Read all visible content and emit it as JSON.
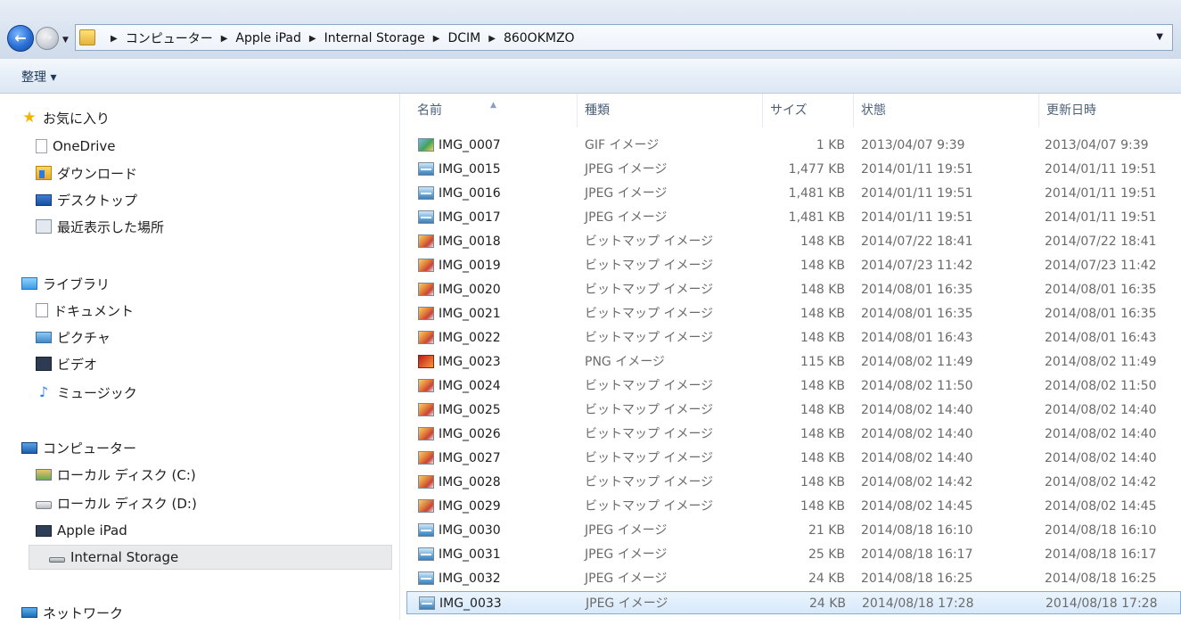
{
  "address": {
    "breadcrumbs": [
      "コンピューター",
      "Apple iPad",
      "Internal Storage",
      "DCIM",
      "860OKMZO"
    ]
  },
  "toolbar": {
    "organize_label": "整理 ▾"
  },
  "nav": {
    "favorites": {
      "label": "お気に入り",
      "items": [
        "OneDrive",
        "ダウンロード",
        "デスクトップ",
        "最近表示した場所"
      ]
    },
    "libraries": {
      "label": "ライブラリ",
      "items": [
        "ドキュメント",
        "ピクチャ",
        "ビデオ",
        "ミュージック"
      ]
    },
    "computer": {
      "label": "コンピューター",
      "items": [
        "ローカル ディスク (C:)",
        "ローカル ディスク (D:)",
        "Apple iPad",
        "Internal Storage"
      ]
    },
    "network": {
      "label": "ネットワーク"
    }
  },
  "columns": {
    "name": "名前",
    "type": "種類",
    "size": "サイズ",
    "status": "状態",
    "modified": "更新日時"
  },
  "files": [
    {
      "name": "IMG_0007",
      "type": "GIF イメージ",
      "size": "1 KB",
      "status": "2013/04/07 9:39",
      "modified": "2013/04/07 9:39",
      "icon": "gif-file-icon"
    },
    {
      "name": "IMG_0015",
      "type": "JPEG イメージ",
      "size": "1,477 KB",
      "status": "2014/01/11 19:51",
      "modified": "2014/01/11 19:51",
      "icon": "jpeg-file-icon"
    },
    {
      "name": "IMG_0016",
      "type": "JPEG イメージ",
      "size": "1,481 KB",
      "status": "2014/01/11 19:51",
      "modified": "2014/01/11 19:51",
      "icon": "jpeg-file-icon"
    },
    {
      "name": "IMG_0017",
      "type": "JPEG イメージ",
      "size": "1,481 KB",
      "status": "2014/01/11 19:51",
      "modified": "2014/01/11 19:51",
      "icon": "jpeg-file-icon"
    },
    {
      "name": "IMG_0018",
      "type": "ビットマップ イメージ",
      "size": "148 KB",
      "status": "2014/07/22 18:41",
      "modified": "2014/07/22 18:41",
      "icon": "bitmap-file-icon"
    },
    {
      "name": "IMG_0019",
      "type": "ビットマップ イメージ",
      "size": "148 KB",
      "status": "2014/07/23 11:42",
      "modified": "2014/07/23 11:42",
      "icon": "bitmap-file-icon"
    },
    {
      "name": "IMG_0020",
      "type": "ビットマップ イメージ",
      "size": "148 KB",
      "status": "2014/08/01 16:35",
      "modified": "2014/08/01 16:35",
      "icon": "bitmap-file-icon"
    },
    {
      "name": "IMG_0021",
      "type": "ビットマップ イメージ",
      "size": "148 KB",
      "status": "2014/08/01 16:35",
      "modified": "2014/08/01 16:35",
      "icon": "bitmap-file-icon"
    },
    {
      "name": "IMG_0022",
      "type": "ビットマップ イメージ",
      "size": "148 KB",
      "status": "2014/08/01 16:43",
      "modified": "2014/08/01 16:43",
      "icon": "bitmap-file-icon"
    },
    {
      "name": "IMG_0023",
      "type": "PNG イメージ",
      "size": "115 KB",
      "status": "2014/08/02 11:49",
      "modified": "2014/08/02 11:49",
      "icon": "png-file-icon"
    },
    {
      "name": "IMG_0024",
      "type": "ビットマップ イメージ",
      "size": "148 KB",
      "status": "2014/08/02 11:50",
      "modified": "2014/08/02 11:50",
      "icon": "bitmap-file-icon"
    },
    {
      "name": "IMG_0025",
      "type": "ビットマップ イメージ",
      "size": "148 KB",
      "status": "2014/08/02 14:40",
      "modified": "2014/08/02 14:40",
      "icon": "bitmap-file-icon"
    },
    {
      "name": "IMG_0026",
      "type": "ビットマップ イメージ",
      "size": "148 KB",
      "status": "2014/08/02 14:40",
      "modified": "2014/08/02 14:40",
      "icon": "bitmap-file-icon"
    },
    {
      "name": "IMG_0027",
      "type": "ビットマップ イメージ",
      "size": "148 KB",
      "status": "2014/08/02 14:40",
      "modified": "2014/08/02 14:40",
      "icon": "bitmap-file-icon"
    },
    {
      "name": "IMG_0028",
      "type": "ビットマップ イメージ",
      "size": "148 KB",
      "status": "2014/08/02 14:42",
      "modified": "2014/08/02 14:42",
      "icon": "bitmap-file-icon"
    },
    {
      "name": "IMG_0029",
      "type": "ビットマップ イメージ",
      "size": "148 KB",
      "status": "2014/08/02 14:45",
      "modified": "2014/08/02 14:45",
      "icon": "bitmap-file-icon"
    },
    {
      "name": "IMG_0030",
      "type": "JPEG イメージ",
      "size": "21 KB",
      "status": "2014/08/18 16:10",
      "modified": "2014/08/18 16:10",
      "icon": "jpeg-file-icon"
    },
    {
      "name": "IMG_0031",
      "type": "JPEG イメージ",
      "size": "25 KB",
      "status": "2014/08/18 16:17",
      "modified": "2014/08/18 16:17",
      "icon": "jpeg-file-icon"
    },
    {
      "name": "IMG_0032",
      "type": "JPEG イメージ",
      "size": "24 KB",
      "status": "2014/08/18 16:25",
      "modified": "2014/08/18 16:25",
      "icon": "jpeg-file-icon"
    },
    {
      "name": "IMG_0033",
      "type": "JPEG イメージ",
      "size": "24 KB",
      "status": "2014/08/18 17:28",
      "modified": "2014/08/18 17:28",
      "icon": "jpeg-file-icon",
      "selected": true
    }
  ]
}
